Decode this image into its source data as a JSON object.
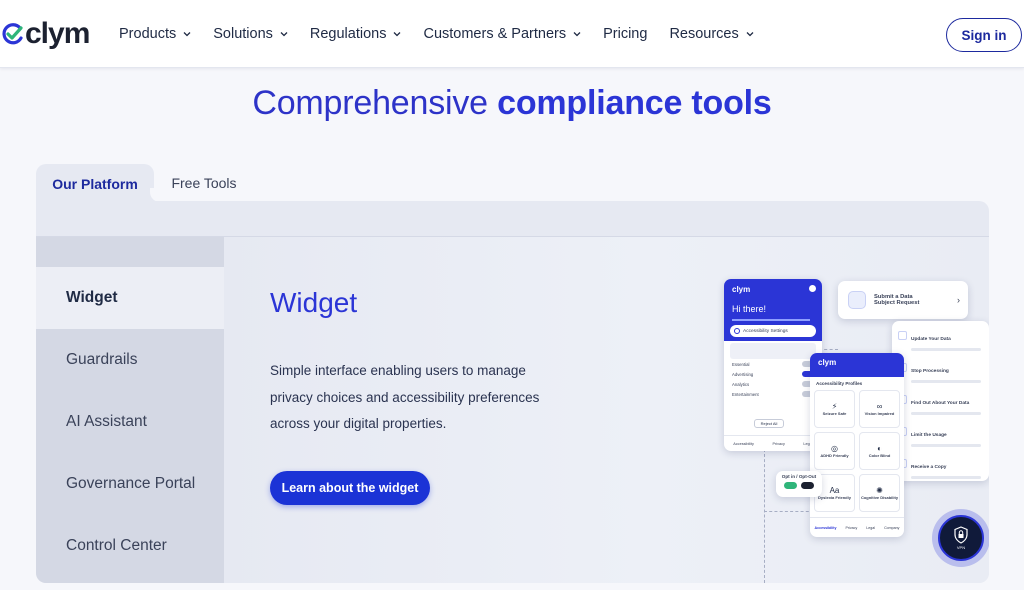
{
  "header": {
    "logo_text": "clym",
    "nav": [
      {
        "label": "Products",
        "has_dropdown": true
      },
      {
        "label": "Solutions",
        "has_dropdown": true
      },
      {
        "label": "Regulations",
        "has_dropdown": true
      },
      {
        "label": "Customers & Partners",
        "has_dropdown": true
      },
      {
        "label": "Pricing",
        "has_dropdown": false
      },
      {
        "label": "Resources",
        "has_dropdown": true
      }
    ],
    "signin_label": "Sign in"
  },
  "headline": {
    "light": "Comprehensive ",
    "bold": "compliance tools"
  },
  "tabs": [
    {
      "label": "Our Platform",
      "active": true
    },
    {
      "label": "Free Tools",
      "active": false
    }
  ],
  "sidebar": {
    "items": [
      {
        "label": "Widget",
        "active": true
      },
      {
        "label": "Guardrails",
        "active": false
      },
      {
        "label": "AI Assistant",
        "active": false
      },
      {
        "label": "Governance Portal",
        "active": false
      },
      {
        "label": "Control Center",
        "active": false
      }
    ]
  },
  "content": {
    "title": "Widget",
    "description": "Simple interface enabling users to manage privacy choices and accessibility preferences across your digital properties.",
    "cta_label": "Learn about the widget"
  },
  "illustration": {
    "widget_logo": "clym",
    "greeting": "Hi there!",
    "accessibility_settings": "Accessibility Settings",
    "consent_rows": [
      "Essential",
      "Advertising",
      "Analytics",
      "Entertainment"
    ],
    "reject_all": "Reject All",
    "footer_tabs": [
      "Accessibility",
      "Privacy",
      "Legal"
    ],
    "request_card": {
      "line1": "Submit a Data",
      "line2": "Subject Request"
    },
    "profiles_card": {
      "logo": "clym",
      "title": "Accessibility Profiles",
      "items": [
        "Seizure Safe",
        "Vision Impaired",
        "ADHD Friendly",
        "Color Blind",
        "Dyslexia Friendly",
        "Cognitive Disability"
      ],
      "footer_tabs": [
        "Accessibility",
        "Privacy",
        "Legal",
        "Company"
      ]
    },
    "rights_card": {
      "items": [
        "Update Your Data",
        "Stop Processing",
        "Find Out About Your Data",
        "Limit the Usage",
        "Receive a Copy"
      ]
    },
    "opt_card": {
      "label": "Opt in / Opt-Out"
    },
    "badge_label": "VPN",
    "colors": {
      "brand_blue": "#2b35d6",
      "cta_blue": "#1b33d6",
      "check_green": "#2fb57a"
    }
  }
}
